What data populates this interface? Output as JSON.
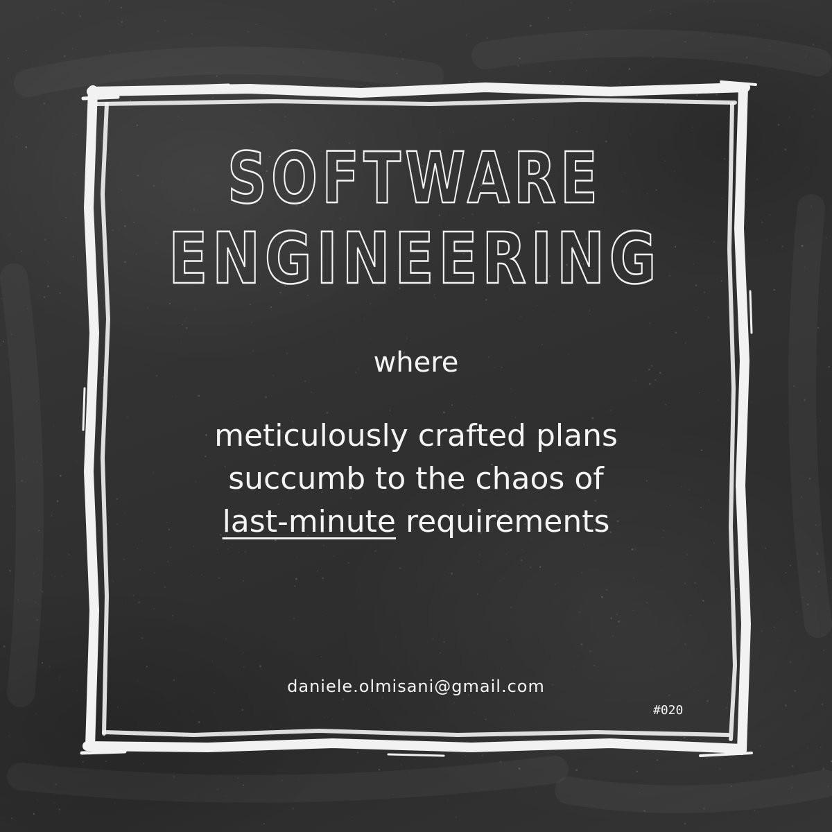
{
  "title": {
    "line1": "SOFTWARE",
    "line2": "ENGINEERING"
  },
  "subtitle": "where",
  "body": {
    "line1": "meticulously crafted plans",
    "line2": "succumb to the chaos of",
    "line3_underlined": "last-minute",
    "line3_rest": " requirements"
  },
  "email": "daniele.olmisani@gmail.com",
  "tag": "#020",
  "colors": {
    "chalkboard": "#2f2f2f",
    "chalk": "#f4f4f4"
  },
  "decor": {
    "frame": "chalk-frame",
    "background": "chalkboard-texture"
  }
}
